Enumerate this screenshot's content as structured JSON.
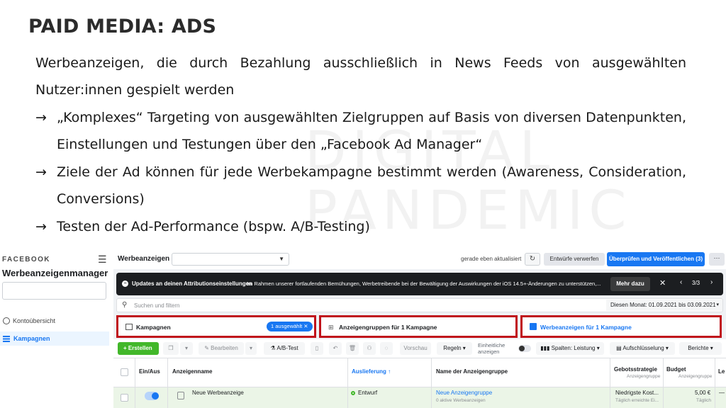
{
  "slide": {
    "title": "PAID MEDIA: ADS",
    "intro": "Werbeanzeigen, die durch Bezahlung ausschließlich in News Feeds von ausgewählten Nutzer:innen gespielt werden",
    "bullets": [
      "„Komplexes“ Targeting von ausgewählten Zielgruppen auf Basis von diversen Datenpunkten, Einstellungen und Testungen über den „Facebook Ad Manager“",
      "Ziele der Ad können für jede Werbekampagne bestimmt werden (Awareness, Consideration, Conversions)",
      "Testen der Ad-Performance (bspw. A/B-Testing)"
    ],
    "bullet_arrow": "→",
    "watermark": [
      "DIGITAL",
      "PANDEMIC"
    ]
  },
  "sidebar": {
    "logo": "FACEBOOK",
    "menu_icon": "☰",
    "app_title": "Werbeanzeigenmanager",
    "nav": [
      {
        "label": "Kontoübersicht",
        "icon": "overview-icon"
      },
      {
        "label": "Kampagnen",
        "icon": "campaigns-icon",
        "active": true
      }
    ]
  },
  "topbar": {
    "label": "Werbeanzeigen",
    "caret": "▼",
    "updated": "gerade eben aktualisiert",
    "refresh_icon": "↻",
    "discard": "Entwürfe verwerfen",
    "publish": "Überprüfen und Veröffentlichen (3)",
    "more": "···"
  },
  "banner": {
    "title": "Updates an deinen Attributionseinstellungen",
    "desc": "Im Rahmen unserer fortlaufenden Bemühungen, Werbetreibende bei der Bewältigung der Auswirkungen der iOS 14.5+-Änderungen zu unterstützen,...",
    "button": "Mehr dazu",
    "close": "✕",
    "prev": "‹",
    "page": "3/3",
    "next": "›"
  },
  "search": {
    "icon": "⚲",
    "placeholder": "Suchen und filtern",
    "date_range": "Diesen Monat: 01.09.2021 bis 03.09.2021",
    "caret": "▾"
  },
  "tabs": [
    {
      "label": "Kampagnen",
      "badge": "1 ausgewählt ✕"
    },
    {
      "label": "Anzeigengruppen für 1 Kampagne",
      "icon": "⊞"
    },
    {
      "label": "Werbeanzeigen für 1 Kampagne"
    }
  ],
  "actions": {
    "create": "+ Erstellen",
    "edit": "✎ Bearbeiten",
    "ab_test": "⚗ A/B-Test",
    "preview": "Vorschau",
    "rules": "Regeln ▾",
    "inline_line1": "Einheitliche",
    "inline_line2": "anzeigen",
    "columns": "▮▮▮ Spalten: Leistung ▾",
    "breakdown": "▤ Aufschlüsselung ▾",
    "reports": "Berichte ▾"
  },
  "table": {
    "headers": {
      "onoff": "Ein/Aus",
      "name": "Anzeigenname",
      "delivery": "Auslieferung ↑",
      "adset": "Name der Anzeigengruppe",
      "bid": "Gebotsstrategie",
      "bid_sub": "Anzeigengruppe",
      "budget": "Budget",
      "budget_sub": "Anzeigengruppe",
      "extra": "Le"
    },
    "rows": [
      {
        "name": "Neue Werbeanzeige",
        "delivery": "Entwurf",
        "adset": "Neue Anzeigengruppe",
        "adset_sub": "0 aktive Werbeanzeigen",
        "bid": "Niedrigste Kost...",
        "bid_sub": "Täglich erreichte Ei...",
        "budget": "5,00 €",
        "budget_sub": "Täglich",
        "extra": "—"
      }
    ]
  }
}
